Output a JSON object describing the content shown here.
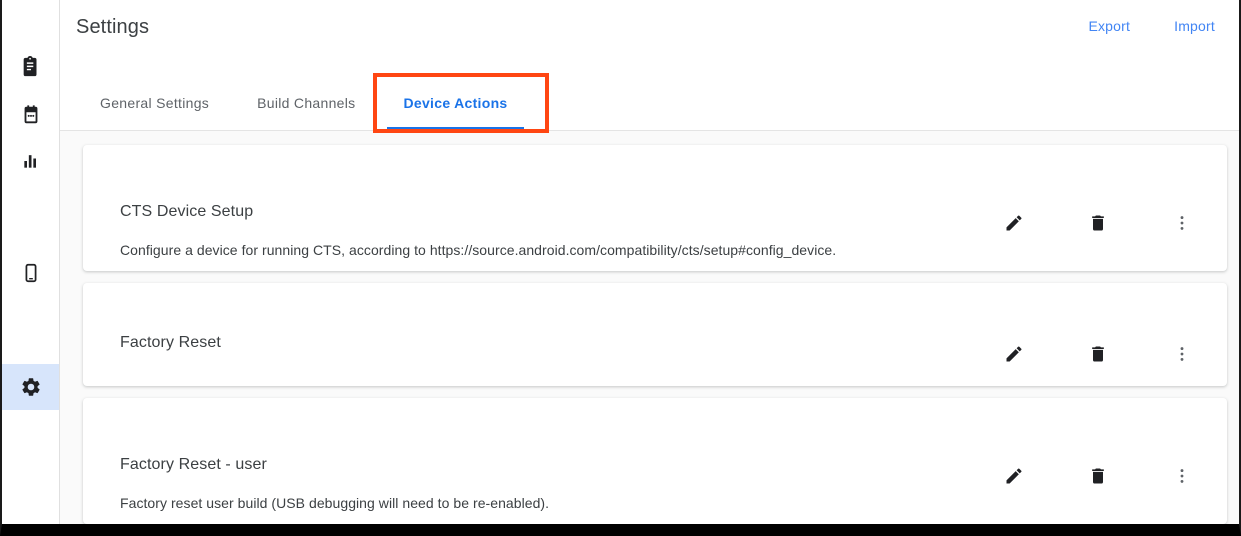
{
  "header": {
    "title": "Settings",
    "links": [
      {
        "label": "Export",
        "name": "export-link"
      },
      {
        "label": "Import",
        "name": "import-link"
      }
    ]
  },
  "tabs": [
    {
      "label": "General Settings",
      "active": false
    },
    {
      "label": "Build Channels",
      "active": false
    },
    {
      "label": "Device Actions",
      "active": true
    }
  ],
  "sidebar": {
    "items": [
      {
        "icon": "clipboard-icon",
        "selected": false
      },
      {
        "icon": "calendar-icon",
        "selected": false
      },
      {
        "icon": "bar-chart-icon",
        "selected": false
      },
      {
        "icon": "device-phone-icon",
        "selected": false
      },
      {
        "icon": "gear-icon",
        "selected": true
      }
    ]
  },
  "cards": [
    {
      "title": "CTS Device Setup",
      "description": "Configure a device for running CTS, according to https://source.android.com/compatibility/cts/setup#config_device.",
      "actions": [
        "edit-icon",
        "delete-icon",
        "more-options-icon"
      ]
    },
    {
      "title": "Factory Reset",
      "description": "",
      "actions": [
        "edit-icon",
        "delete-icon",
        "more-options-icon"
      ]
    },
    {
      "title": "Factory Reset - user",
      "description": "Factory reset user build (USB debugging will need to be re-enabled).",
      "actions": [
        "edit-icon",
        "delete-icon",
        "more-options-icon"
      ]
    }
  ],
  "colors": {
    "accent": "#1a73e8",
    "link": "#4285f4",
    "annotation": "#ff4612",
    "selected_nav": "#d7e5fb",
    "content_bg": "#fafafa"
  }
}
